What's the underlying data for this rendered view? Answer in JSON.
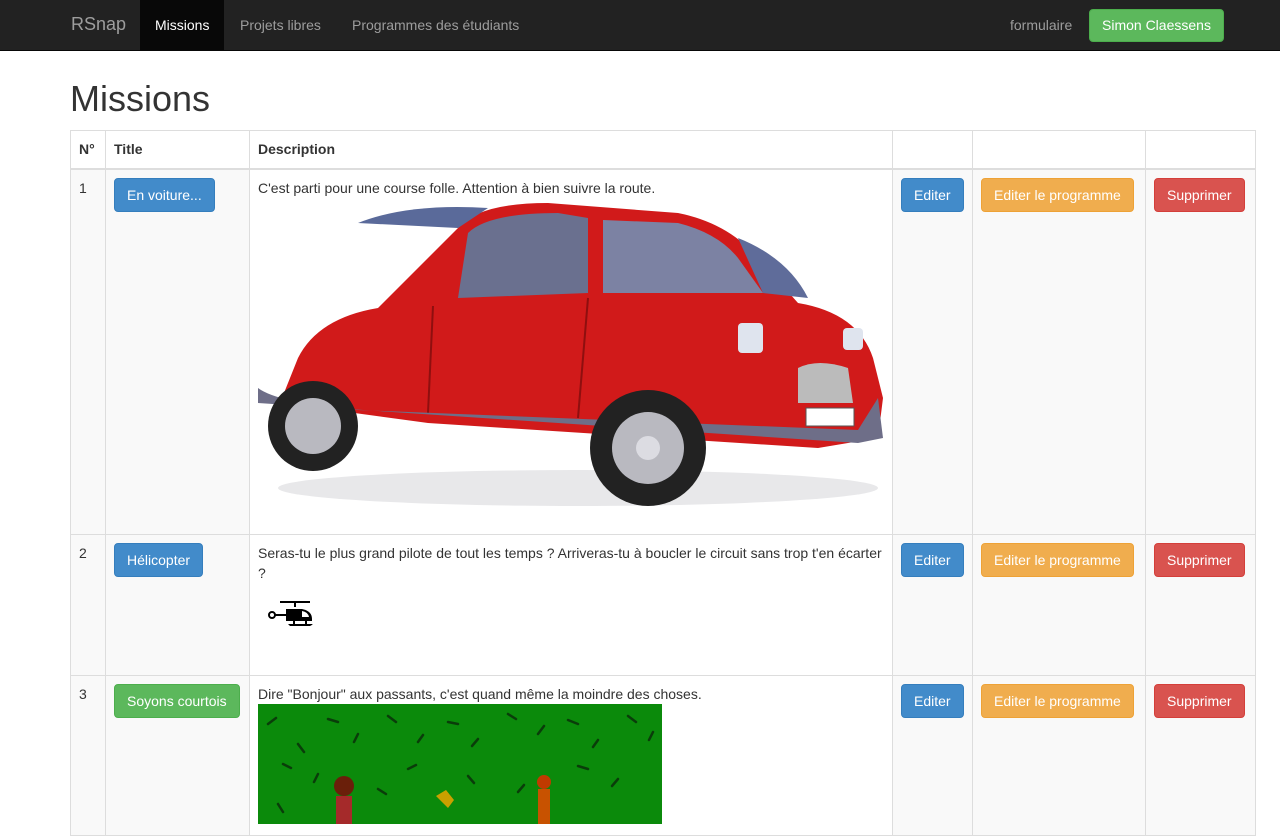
{
  "navbar": {
    "brand": "RSnap",
    "items": [
      {
        "label": "Missions",
        "active": true
      },
      {
        "label": "Projets libres",
        "active": false
      },
      {
        "label": "Programmes des étudiants",
        "active": false
      }
    ],
    "right_link": "formulaire",
    "user_button": "Simon Claessens"
  },
  "page": {
    "title": "Missions"
  },
  "table": {
    "headers": [
      "N°",
      "Title",
      "Description",
      "",
      "",
      ""
    ],
    "rows": [
      {
        "number": "1",
        "title": "En voiture...",
        "title_color": "primary",
        "description": "C'est parti pour une course folle. Attention à bien suivre la route.",
        "image_icon": "red-car-icon",
        "edit_label": "Editer",
        "edit_program_label": "Editer le programme",
        "delete_label": "Supprimer"
      },
      {
        "number": "2",
        "title": "Hélicopter",
        "title_color": "primary",
        "description": "Seras-tu le plus grand pilote de tout les temps ? Arriveras-tu à boucler le circuit sans trop t'en écarter ?",
        "image_icon": "helicopter-icon",
        "edit_label": "Editer",
        "edit_program_label": "Editer le programme",
        "delete_label": "Supprimer"
      },
      {
        "number": "3",
        "title": "Soyons courtois",
        "title_color": "success",
        "description": "Dire \"Bonjour\" aux passants, c'est quand même la moindre des choses.",
        "image_icon": "grass-scene-icon",
        "edit_label": "Editer",
        "edit_program_label": "Editer le programme",
        "delete_label": "Supprimer"
      }
    ]
  },
  "colors": {
    "navbar_bg": "#222222",
    "primary": "#428bca",
    "success": "#5cb85c",
    "warning": "#f0ad4e",
    "danger": "#d9534f"
  }
}
